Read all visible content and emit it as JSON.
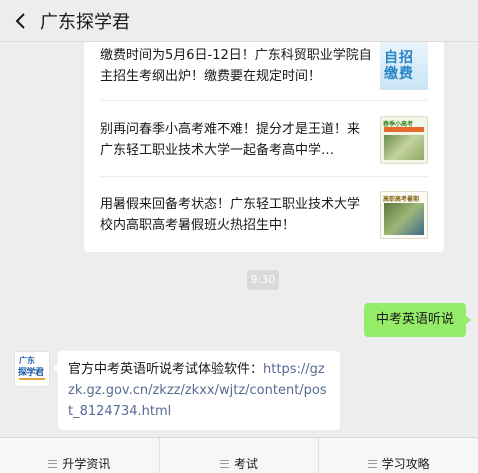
{
  "header": {
    "title": "广东探学君"
  },
  "articles": [
    {
      "text": "缴费时间为5月6日-12日！广东科贸职业学院自主招生考纲出炉！缴费要在规定时间！",
      "thumb_label": "自招\n缴费"
    },
    {
      "text": "别再问春季小高考难不难！提分才是王道！来广东轻工职业技术大学一起备考高中学…",
      "thumb_label": "春季小高考"
    },
    {
      "text": "用暑假来回备考状态！广东轻工职业技术大学校内高职高考暑假班火热招生中！",
      "thumb_label": "高职高考暑期"
    }
  ],
  "timestamp": "9:30",
  "outgoing_message": "中考英语听说",
  "avatar": {
    "label": "探学君",
    "top_label": "广东"
  },
  "incoming_message": {
    "prefix": "官方中考英语听说考试体验软件：",
    "link": "https://gzzk.gz.gov.cn/zkzz/zkxx/wjtz/content/post_8124734.html"
  },
  "bottom_tabs": [
    {
      "label": "升学资讯"
    },
    {
      "label": "考试"
    },
    {
      "label": "学习攻略"
    }
  ],
  "colors": {
    "background": "#ededed",
    "outgoing_bubble": "#95ec69",
    "link": "#576b95"
  }
}
